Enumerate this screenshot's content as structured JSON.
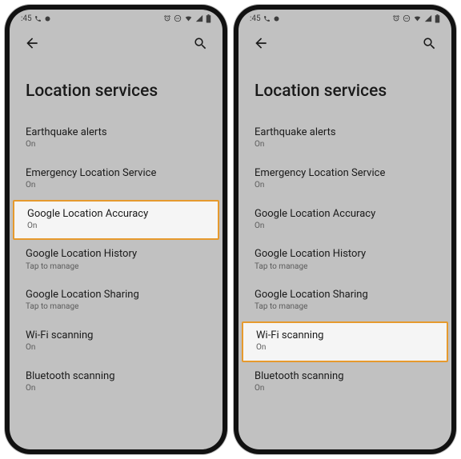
{
  "statusbar": {
    "time": ":45"
  },
  "title": "Location services",
  "screens": [
    {
      "highlight_index": 2
    },
    {
      "highlight_index": 5
    }
  ],
  "items": [
    {
      "label": "Earthquake alerts",
      "sub": "On"
    },
    {
      "label": "Emergency Location Service",
      "sub": "On"
    },
    {
      "label": "Google Location Accuracy",
      "sub": "On"
    },
    {
      "label": "Google Location History",
      "sub": "Tap to manage"
    },
    {
      "label": "Google Location Sharing",
      "sub": "Tap to manage"
    },
    {
      "label": "Wi-Fi scanning",
      "sub": "On"
    },
    {
      "label": "Bluetooth scanning",
      "sub": "On"
    }
  ]
}
